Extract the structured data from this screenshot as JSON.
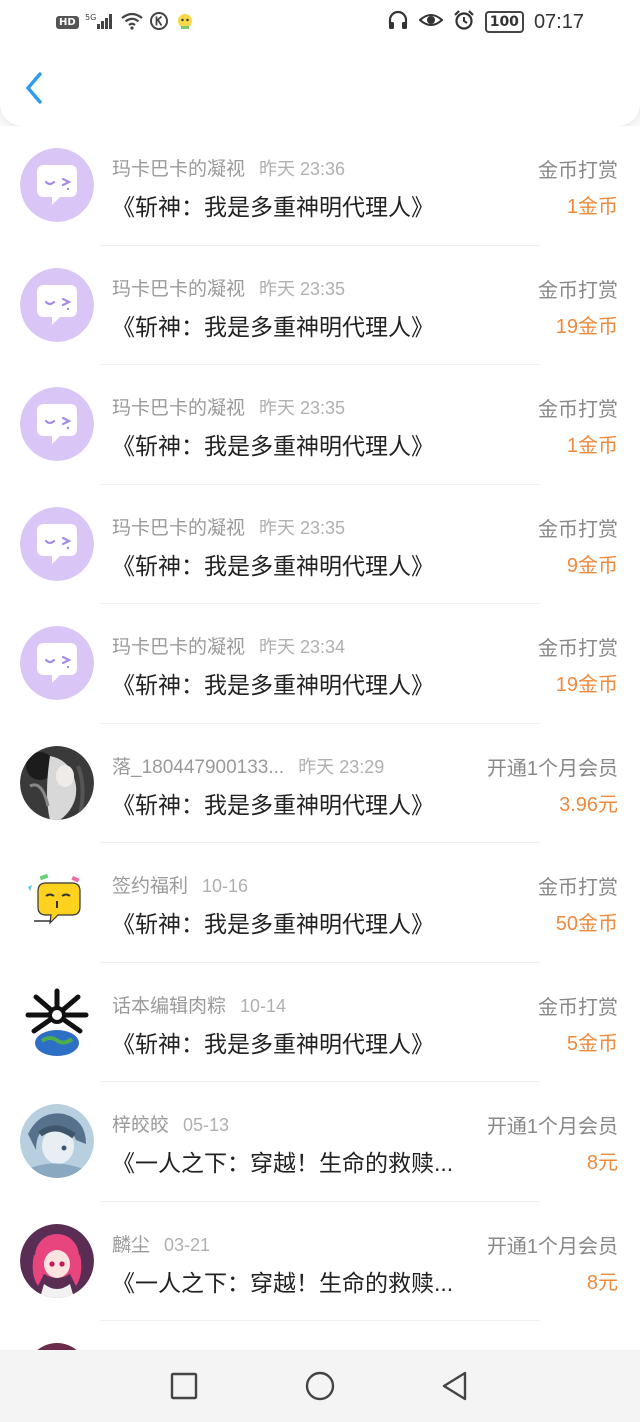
{
  "status": {
    "left_badge": "HD",
    "signal_label": "5G",
    "battery": "100",
    "time": "07:17"
  },
  "records": [
    {
      "name": "玛卡巴卡的凝视",
      "time": "昨天 23:36",
      "title": "《斩神：我是多重神明代理人》",
      "type": "金币打赏",
      "amount": "1金币",
      "avatar": "bubble"
    },
    {
      "name": "玛卡巴卡的凝视",
      "time": "昨天 23:35",
      "title": "《斩神：我是多重神明代理人》",
      "type": "金币打赏",
      "amount": "19金币",
      "avatar": "bubble"
    },
    {
      "name": "玛卡巴卡的凝视",
      "time": "昨天 23:35",
      "title": "《斩神：我是多重神明代理人》",
      "type": "金币打赏",
      "amount": "1金币",
      "avatar": "bubble"
    },
    {
      "name": "玛卡巴卡的凝视",
      "time": "昨天 23:35",
      "title": "《斩神：我是多重神明代理人》",
      "type": "金币打赏",
      "amount": "9金币",
      "avatar": "bubble"
    },
    {
      "name": "玛卡巴卡的凝视",
      "time": "昨天 23:34",
      "title": "《斩神：我是多重神明代理人》",
      "type": "金币打赏",
      "amount": "19金币",
      "avatar": "bubble"
    },
    {
      "name": "落_180447900133...",
      "time": "昨天 23:29",
      "title": "《斩神：我是多重神明代理人》",
      "type": "开通1个月会员",
      "amount": "3.96元",
      "avatar": "photo-dark"
    },
    {
      "name": "签约福利",
      "time": "10-16",
      "title": "《斩神：我是多重神明代理人》",
      "type": "金币打赏",
      "amount": "50金币",
      "avatar": "yellow-bubble"
    },
    {
      "name": "话本编辑肉粽",
      "time": "10-14",
      "title": "《斩神：我是多重神明代理人》",
      "type": "金币打赏",
      "amount": "5金币",
      "avatar": "earth"
    },
    {
      "name": "梓皎皎",
      "time": "05-13",
      "title": "《一人之下：穿越！生命的救赎...",
      "type": "开通1个月会员",
      "amount": "8元",
      "avatar": "photo-blue"
    },
    {
      "name": "麟尘",
      "time": "03-21",
      "title": "《一人之下：穿越！生命的救赎...",
      "type": "开通1个月会员",
      "amount": "8元",
      "avatar": "photo-pink"
    }
  ],
  "colors": {
    "accent": "#2a9bf0",
    "amount": "#ef8a3d",
    "avatar_bg": "#d9c6f7"
  }
}
